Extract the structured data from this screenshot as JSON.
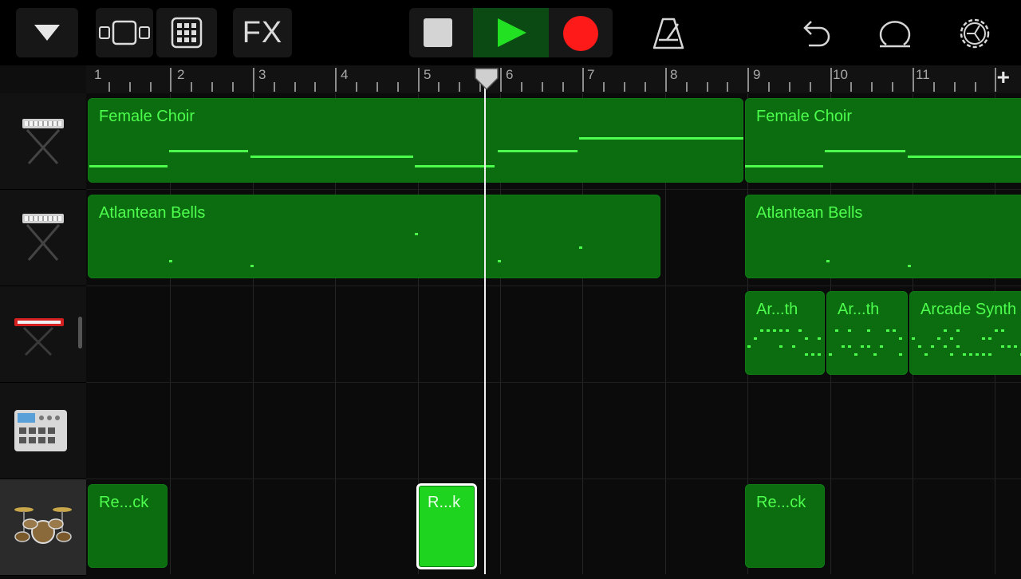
{
  "toolbar": {
    "fx_label": "FX",
    "icons": [
      "browser-dropdown-icon",
      "tracks-view-icon",
      "grid-view-icon",
      "stop-icon",
      "play-icon",
      "record-icon",
      "metronome-icon",
      "undo-icon",
      "loop-icon",
      "settings-icon"
    ]
  },
  "ruler": {
    "bars": [
      "1",
      "2",
      "3",
      "4",
      "5",
      "6",
      "7",
      "8",
      "9",
      "10",
      "11"
    ],
    "add_label": "+"
  },
  "tracks": [
    {
      "instrument": "keyboard",
      "icon": "keyboard-stand-icon"
    },
    {
      "instrument": "keyboard",
      "icon": "keyboard-stand-icon"
    },
    {
      "instrument": "synth",
      "icon": "red-synth-icon"
    },
    {
      "instrument": "beat-sequencer",
      "icon": "drum-machine-icon"
    },
    {
      "instrument": "drums",
      "icon": "drum-kit-icon"
    }
  ],
  "regions": {
    "choir_1": "Female Choir",
    "choir_2": "Female Choir",
    "bells_1": "Atlantean Bells",
    "bells_2": "Atlantean Bells",
    "arcade_1": "Ar...th",
    "arcade_2": "Ar...th",
    "arcade_3": "Arcade Synth",
    "drums_1": "Re...ck",
    "drums_2": "R...k",
    "drums_3": "Re...ck"
  },
  "colors": {
    "region": "#0c6c10",
    "region_text": "#4dff4d",
    "selected_region": "#1ed41e",
    "record": "#ff1a1a",
    "play_bg": "#0c4a14"
  }
}
